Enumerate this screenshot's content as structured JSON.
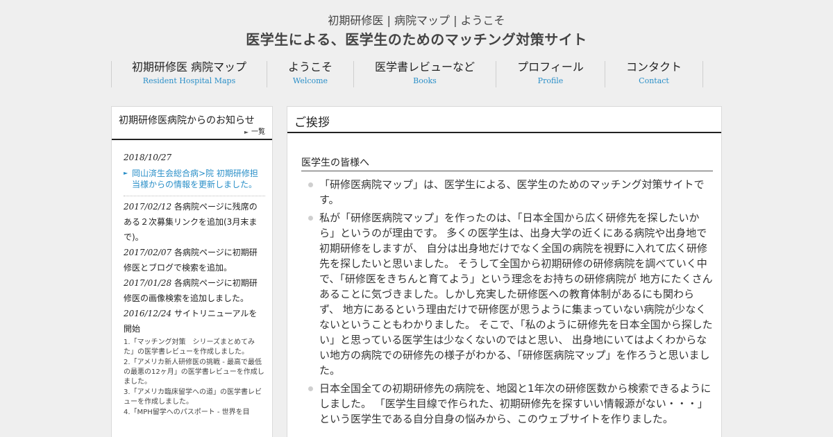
{
  "header": {
    "subtitle": "初期研修医 | 病院マップ | ようこそ",
    "title": "医学生による、医学生のためのマッチング対策サイト"
  },
  "nav": [
    {
      "label": "初期研修医 病院マップ",
      "sub": "Resident Hospital Maps"
    },
    {
      "label": "ようこそ",
      "sub": "Welcome"
    },
    {
      "label": "医学書レビューなど",
      "sub": "Books"
    },
    {
      "label": "プロフィール",
      "sub": "Profile"
    },
    {
      "label": "コンタクト",
      "sub": "Contact"
    }
  ],
  "sidebar": {
    "title": "初期研修医病院からのお知らせ",
    "more": "一覧",
    "first_date": "2018/10/27",
    "first_link": "岡山済生会総合病>院 初期研修担当様からの情報を更新しました。",
    "news": [
      {
        "date": "2017/02/12",
        "text": " 各病院ページに残席のある２次募集リンクを追加(3月末まで)。"
      },
      {
        "date": "2017/02/07",
        "text": " 各病院ページに初期研修医とブログで検索を追加。"
      },
      {
        "date": "2017/01/28",
        "text": " 各病院ページに初期研修医の画像検索を追加しました。"
      },
      {
        "date": "2016/12/24",
        "text": " サイトリニューアルを開始"
      }
    ],
    "small_items": [
      "1.「マッチング対策　シリーズまとめてみた」の医学書レビューを作成しました。",
      "2.「アメリカ新人研修医の挑戦 - 最高で最低の最悪の12ヶ月」の医学書レビューを作成しました。",
      "3.「アメリカ臨床留学への道」の医学書レビューを作成しました。",
      "4.「MPH留学へのパスポート - 世界を目"
    ]
  },
  "main": {
    "heading": "ご挨拶",
    "greeting": "医学生の皆様へ",
    "paragraphs": [
      "「研修医病院マップ」は、医学生による、医学生のためのマッチング対策サイトです。",
      "私が「研修医病院マップ」を作ったのは、「日本全国から広く研修先を探したいから」というのが理由です。 多くの医学生は、出身大学の近くにある病院や出身地で初期研修をしますが、 自分は出身地だけでなく全国の病院を視野に入れて広く研修先を探したいと思いました。 そうして全国から初期研修の研修病院を調べていく中で、「研修医をきちんと育てよう」という理念をお持ちの研修病院が 地方にたくさんあることに気づきました。しかし充実した研修医への教育体制があるにも関わらず、 地方にあるという理由だけで研修医が思うように集まっていない病院が少なくないということもわかりました。 そこで、「私のように研修先を日本全国から探したい」と思っている医学生は少なくないのではと思い、 出身地にいてはよくわからない地方の病院での研修先の様子がわかる、「研修医病院マップ」を作ろうと思いました。",
      "日本全国全ての初期研修先の病院を、地図と1年次の研修医数から検索できるようにしました。 「医学生目線で作られた、初期研修先を探すいい情報源がない・・・」という医学生である自分自身の悩みから、このウェブサイトを作りました。"
    ]
  }
}
